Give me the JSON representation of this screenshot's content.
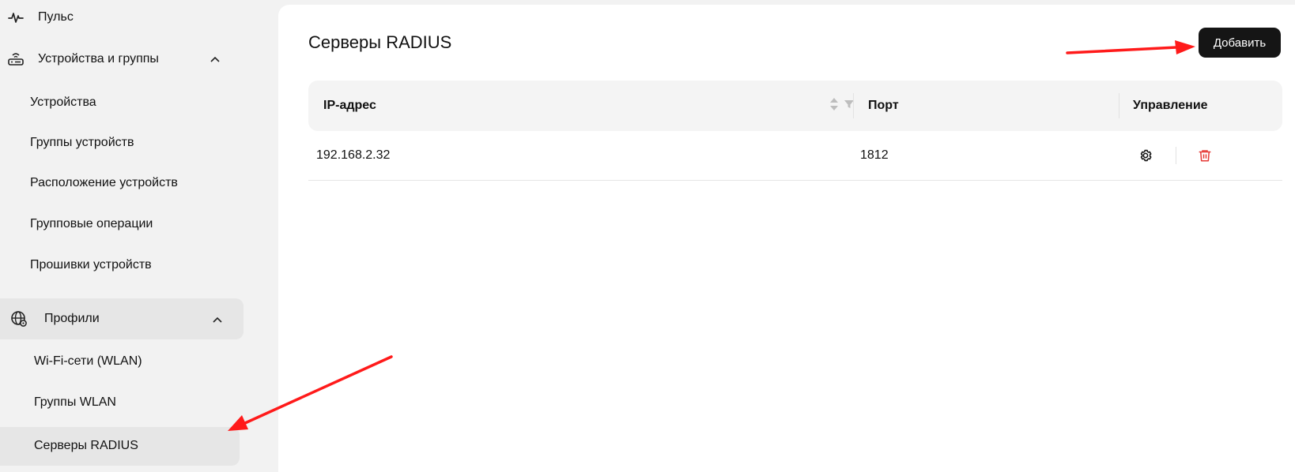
{
  "sidebar": {
    "pulse": {
      "label": "Пульс",
      "icon": "pulse-icon"
    },
    "devices_group": {
      "label": "Устройства и группы",
      "icon": "router-icon",
      "items": [
        {
          "label": "Устройства"
        },
        {
          "label": "Группы устройств"
        },
        {
          "label": "Расположение устройств"
        },
        {
          "label": "Групповые операции"
        },
        {
          "label": "Прошивки устройств"
        }
      ]
    },
    "profiles_group": {
      "label": "Профили",
      "icon": "globe-settings-icon",
      "items": [
        {
          "label": "Wi-Fi-сети (WLAN)"
        },
        {
          "label": "Группы WLAN"
        },
        {
          "label": "Серверы RADIUS"
        }
      ]
    }
  },
  "main": {
    "title": "Серверы RADIUS",
    "add_button": "Добавить",
    "table": {
      "columns": [
        "IP-адрес",
        "Порт",
        "Управление"
      ],
      "rows": [
        {
          "ip": "192.168.2.32",
          "port": "1812"
        }
      ]
    }
  },
  "colors": {
    "accent_dark": "#151515",
    "delete_red": "#e53935",
    "annotation_red": "#ff1a1a"
  }
}
